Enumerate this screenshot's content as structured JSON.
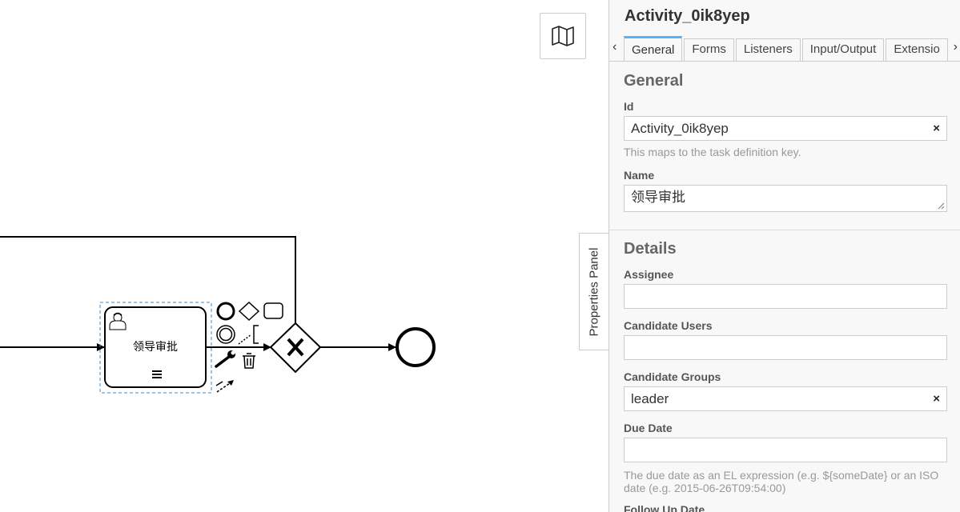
{
  "diagram": {
    "task_label": "领导审批"
  },
  "canvas": {
    "minimap_icon": "map-icon",
    "properties_toggle_label": "Properties Panel"
  },
  "panel": {
    "title": "Activity_0ik8yep",
    "tabs": [
      {
        "label": "General",
        "active": true
      },
      {
        "label": "Forms"
      },
      {
        "label": "Listeners"
      },
      {
        "label": "Input/Output"
      },
      {
        "label": "Extensio"
      }
    ],
    "general": {
      "title": "General",
      "id_label": "Id",
      "id_value": "Activity_0ik8yep",
      "id_hint": "This maps to the task definition key.",
      "name_label": "Name",
      "name_value": "领导审批"
    },
    "details": {
      "title": "Details",
      "assignee_label": "Assignee",
      "assignee_value": "",
      "candidate_users_label": "Candidate Users",
      "candidate_users_value": "",
      "candidate_groups_label": "Candidate Groups",
      "candidate_groups_value": "leader",
      "due_date_label": "Due Date",
      "due_date_value": "",
      "due_date_hint": "The due date as an EL expression (e.g. ${someDate} or an ISO date (e.g. 2015-06-26T09:54:00)",
      "follow_up_label": "Follow Up Date"
    },
    "clear_symbol": "×",
    "scroll_left": "‹",
    "scroll_right": "›"
  },
  "colors": {
    "accent": "#52b4ff",
    "selection": "#3a89c9"
  }
}
